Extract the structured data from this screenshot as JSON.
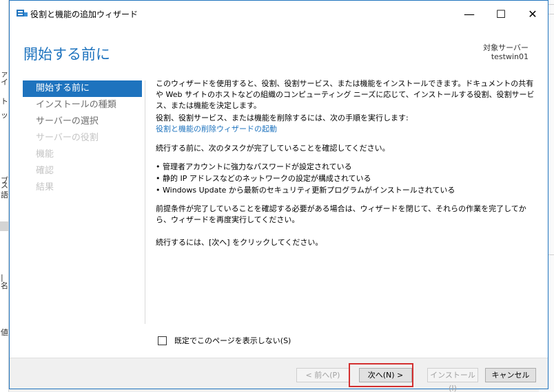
{
  "window": {
    "title": "役割と機能の追加ウィザード",
    "min_glyph": "—",
    "max_glyph": "☐",
    "close_glyph": "✕"
  },
  "header": {
    "title": "開始する前に",
    "target_label": "対象サーバー",
    "target_value": "testwin01"
  },
  "nav": {
    "items": [
      {
        "label": "開始する前に",
        "state": "active"
      },
      {
        "label": "インストールの種類",
        "state": "enabled"
      },
      {
        "label": "サーバーの選択",
        "state": "enabled"
      },
      {
        "label": "サーバーの役割",
        "state": "disabled"
      },
      {
        "label": "機能",
        "state": "disabled"
      },
      {
        "label": "確認",
        "state": "disabled"
      },
      {
        "label": "結果",
        "state": "disabled"
      }
    ]
  },
  "content": {
    "intro": "このウィザードを使用すると、役割、役割サービス、または機能をインストールできます。ドキュメントの共有や Web サイトのホストなどの組織のコンピューティング ニーズに応じて、インストールする役割、役割サービス、または機能を決定します。",
    "remove_text": "役割、役割サービス、または機能を削除するには、次の手順を実行します:",
    "remove_link": "役割と機能の削除ウィザードの起動",
    "verify_text": "続行する前に、次のタスクが完了していることを確認してください。",
    "bullets": [
      "管理者アカウントに強力なパスワードが設定されている",
      "静的 IP アドレスなどのネットワークの設定が構成されている",
      "Windows Update から最新のセキュリティ更新プログラムがインストールされている"
    ],
    "prereq_text": "前提条件が完了していることを確認する必要がある場合は、ウィザードを閉じて、それらの作業を完了してから、ウィザードを再度実行してください。",
    "continue_text": "続行するには、[次へ] をクリックしてください。"
  },
  "skip_checkbox": {
    "label": "既定でこのページを表示しない(S)",
    "checked": false
  },
  "footer": {
    "prev_label": "< 前へ(P)",
    "next_label": "次へ(N) >",
    "install_label": "インストール(I)",
    "cancel_label": "キャンセル"
  },
  "colors": {
    "accent": "#1e73be",
    "highlight_box": "#d32f2f"
  },
  "background": {
    "left_fragments": [
      "ァイ",
      "ト",
      "ッ",
      "ブ",
      "ス",
      "語",
      "値"
    ],
    "left_bar_label": "| 名"
  }
}
